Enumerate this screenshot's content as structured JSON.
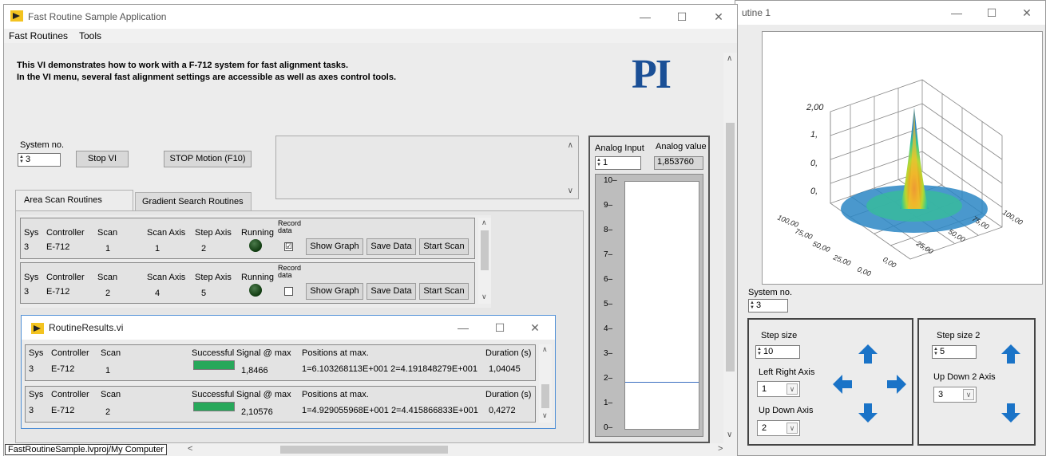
{
  "main_window": {
    "title": "Fast Routine Sample Application",
    "menu": [
      "Fast Routines",
      "Tools"
    ],
    "intro_line1": "This VI demonstrates how to work with a F-712 system for fast alignment tasks.",
    "intro_line2": "In the VI menu, several fast alignment settings are accessible as well as axes control tools.",
    "logo": "PI",
    "system_no_label": "System no.",
    "system_no_value": "3",
    "stop_vi_label": "Stop VI",
    "stop_motion_label": "STOP Motion (F10)",
    "tabs": [
      "Area Scan Routines",
      "Gradient Search Routines"
    ],
    "status_path": "FastRoutineSample.lvproj/My Computer"
  },
  "routines": {
    "headers": {
      "sys": "Sys",
      "controller": "Controller",
      "scan": "Scan",
      "scan_axis": "Scan Axis",
      "step_axis": "Step Axis",
      "running": "Running",
      "record": "Record data"
    },
    "buttons": {
      "show_graph": "Show Graph",
      "save_data": "Save Data",
      "start_scan": "Start Scan"
    },
    "rows": [
      {
        "sys": "3",
        "controller": "E-712",
        "scan": "1",
        "scan_axis": "1",
        "step_axis": "2",
        "record_checked": "☑"
      },
      {
        "sys": "3",
        "controller": "E-712",
        "scan": "2",
        "scan_axis": "4",
        "step_axis": "5",
        "record_checked": ""
      }
    ]
  },
  "analog": {
    "input_label": "Analog Input",
    "value_label": "Analog value",
    "input_value": "1",
    "value": "1,853760",
    "scale": [
      "10",
      "9",
      "8",
      "7",
      "6",
      "5",
      "4",
      "3",
      "2",
      "1",
      "0"
    ],
    "level": 1.85376,
    "max": 10
  },
  "results_window": {
    "title": "RoutineResults.vi",
    "headers": {
      "sys": "Sys",
      "controller": "Controller",
      "scan": "Scan",
      "successful": "Successful",
      "signal": "Signal @ max",
      "positions": "Positions at max.",
      "duration": "Duration (s)"
    },
    "rows": [
      {
        "sys": "3",
        "controller": "E-712",
        "scan": "1",
        "signal": "1,8466",
        "positions": "1=6.103268113E+001 2=4.191848279E+001",
        "duration": "1,04045"
      },
      {
        "sys": "3",
        "controller": "E-712",
        "scan": "2",
        "signal": "2,10576",
        "positions": "1=4.929055968E+001 2=4.415866833E+001",
        "duration": "0,4272"
      }
    ]
  },
  "right_window": {
    "title_fragment": "utine 1",
    "system_no_label": "System no.",
    "system_no_value": "3",
    "z_ticks": [
      "2,00",
      "1,",
      "0,",
      "0,"
    ],
    "x_ticks": [
      "100,00",
      "75,00",
      "50,00",
      "25,00",
      "0,00"
    ],
    "y_ticks": [
      "0,00",
      "25,00",
      "50,00",
      "75,00",
      "100,00"
    ],
    "step_size_label": "Step size",
    "step_size_value": "10",
    "left_right_label": "Left Right Axis",
    "left_right_value": "1",
    "up_down_label": "Up Down Axis",
    "up_down_value": "2",
    "step_size2_label": "Step size 2",
    "step_size2_value": "5",
    "up_down2_label": "Up Down 2 Axis",
    "up_down2_value": "3"
  },
  "colors": {
    "arrow": "#1a73c7",
    "led_off": "#1f4f1f",
    "bar_green": "#27a85a"
  }
}
